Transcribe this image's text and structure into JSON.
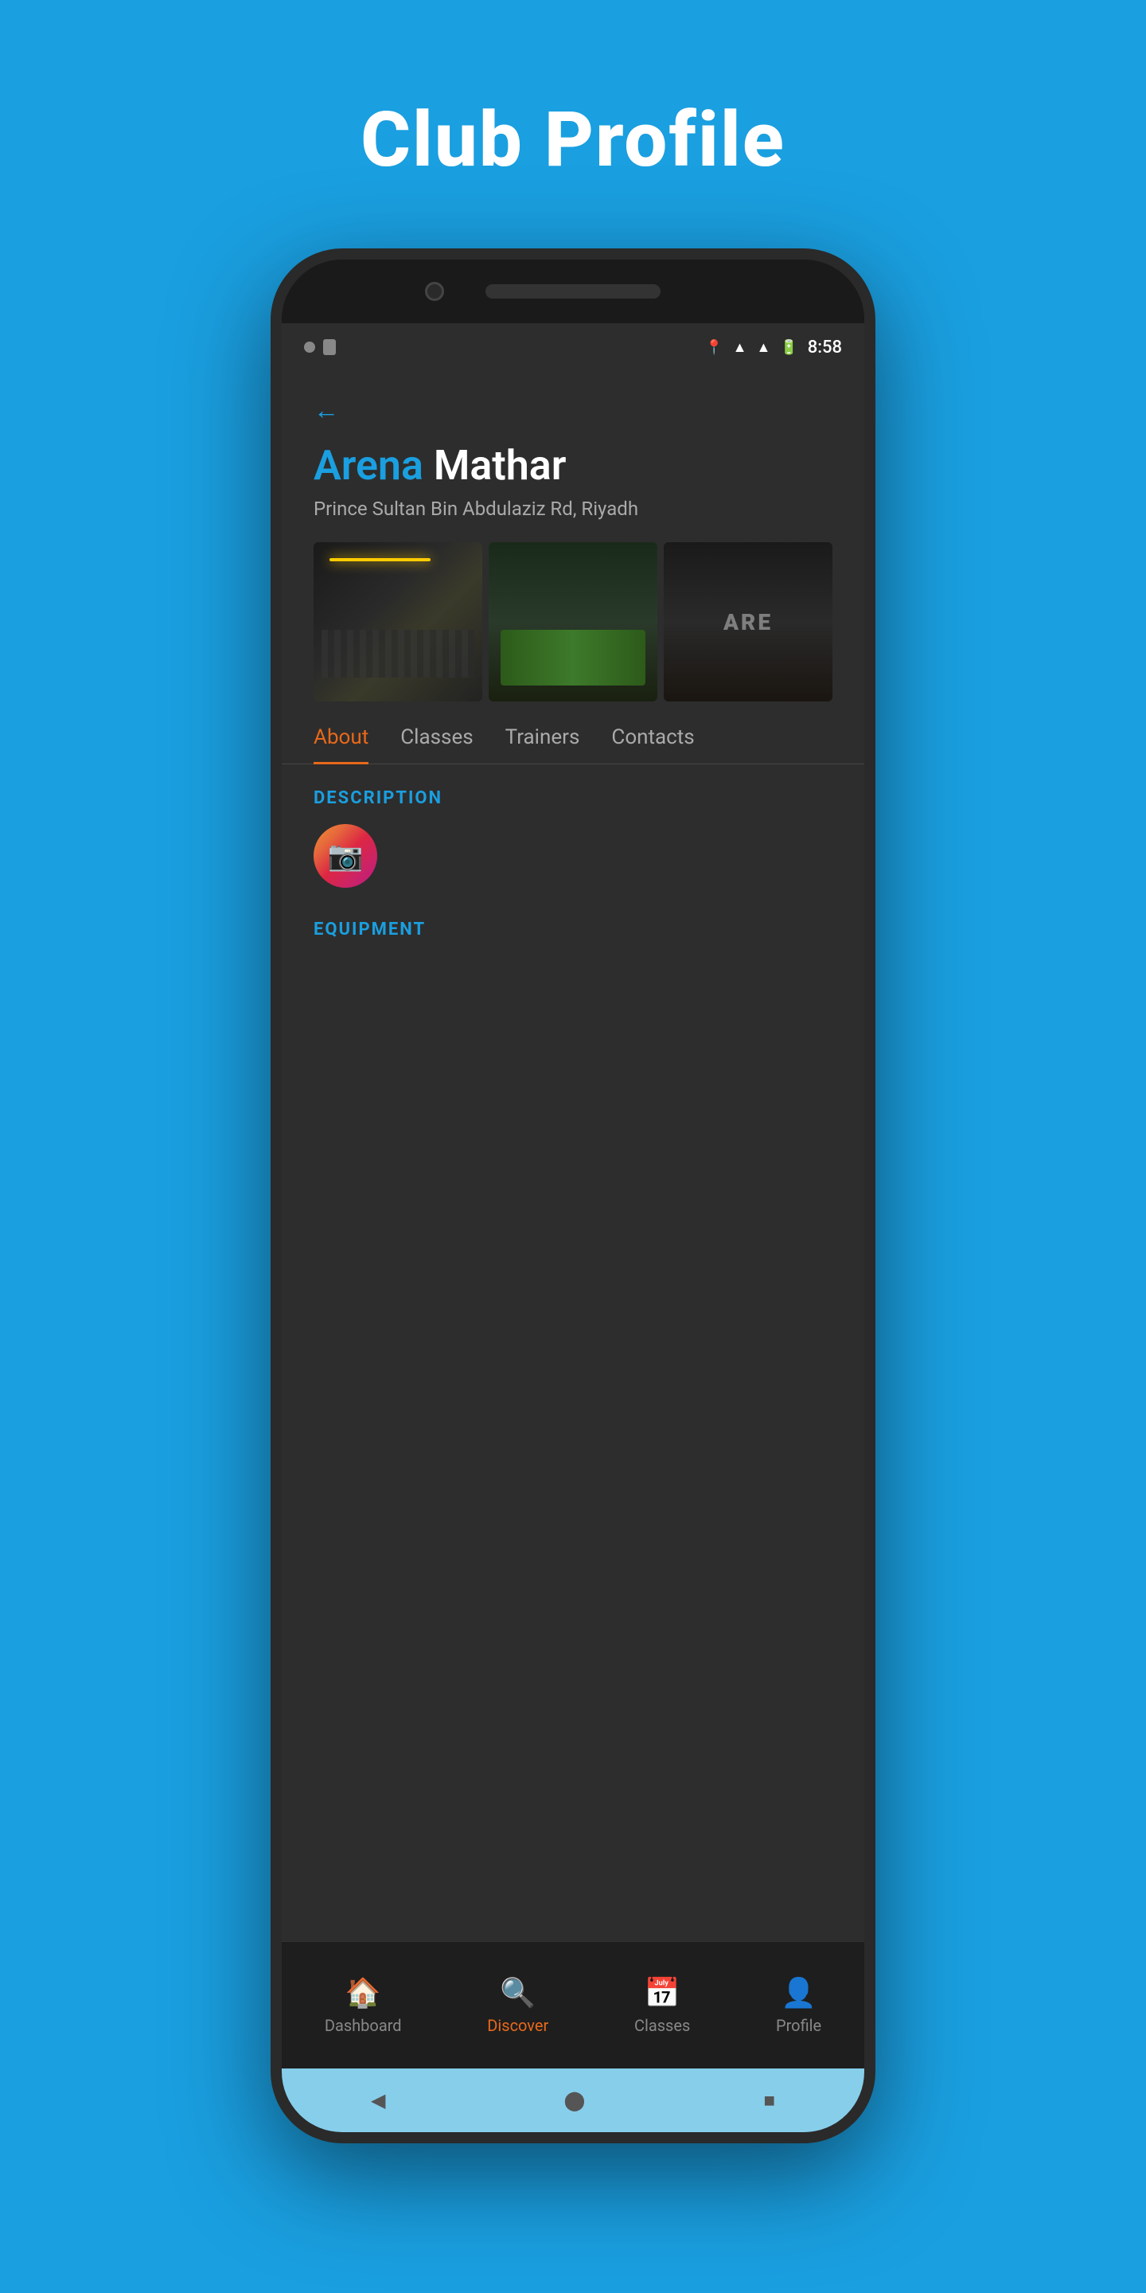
{
  "page": {
    "title": "Club Profile"
  },
  "statusBar": {
    "time": "8:58",
    "icons": [
      "location",
      "wifi",
      "signal",
      "battery"
    ]
  },
  "header": {
    "backLabel": "←",
    "clubNameFirst": "Arena",
    "clubNameSecond": "Mathar",
    "address": "Prince Sultan Bin Abdulaziz Rd, Riyadh"
  },
  "tabs": [
    {
      "id": "about",
      "label": "About",
      "active": true
    },
    {
      "id": "classes",
      "label": "Classes",
      "active": false
    },
    {
      "id": "trainers",
      "label": "Trainers",
      "active": false
    },
    {
      "id": "contacts",
      "label": "Contacts",
      "active": false
    }
  ],
  "content": {
    "descriptionLabel": "DESCRIPTION",
    "equipmentLabel": "EQUIPMENT",
    "instagramAlt": "Instagram"
  },
  "bottomNav": [
    {
      "id": "dashboard",
      "label": "Dashboard",
      "icon": "🏠",
      "active": false
    },
    {
      "id": "discover",
      "label": "Discover",
      "icon": "🔍",
      "active": true
    },
    {
      "id": "classes",
      "label": "Classes",
      "icon": "📅",
      "active": false
    },
    {
      "id": "profile",
      "label": "Profile",
      "icon": "👤",
      "active": false
    }
  ],
  "androidNav": {
    "back": "◀",
    "home": "⬤",
    "recents": "■"
  },
  "colors": {
    "blue": "#1a9fe0",
    "orange": "#e8681a",
    "dark": "#2d2d2d",
    "darker": "#1e1e1e"
  }
}
